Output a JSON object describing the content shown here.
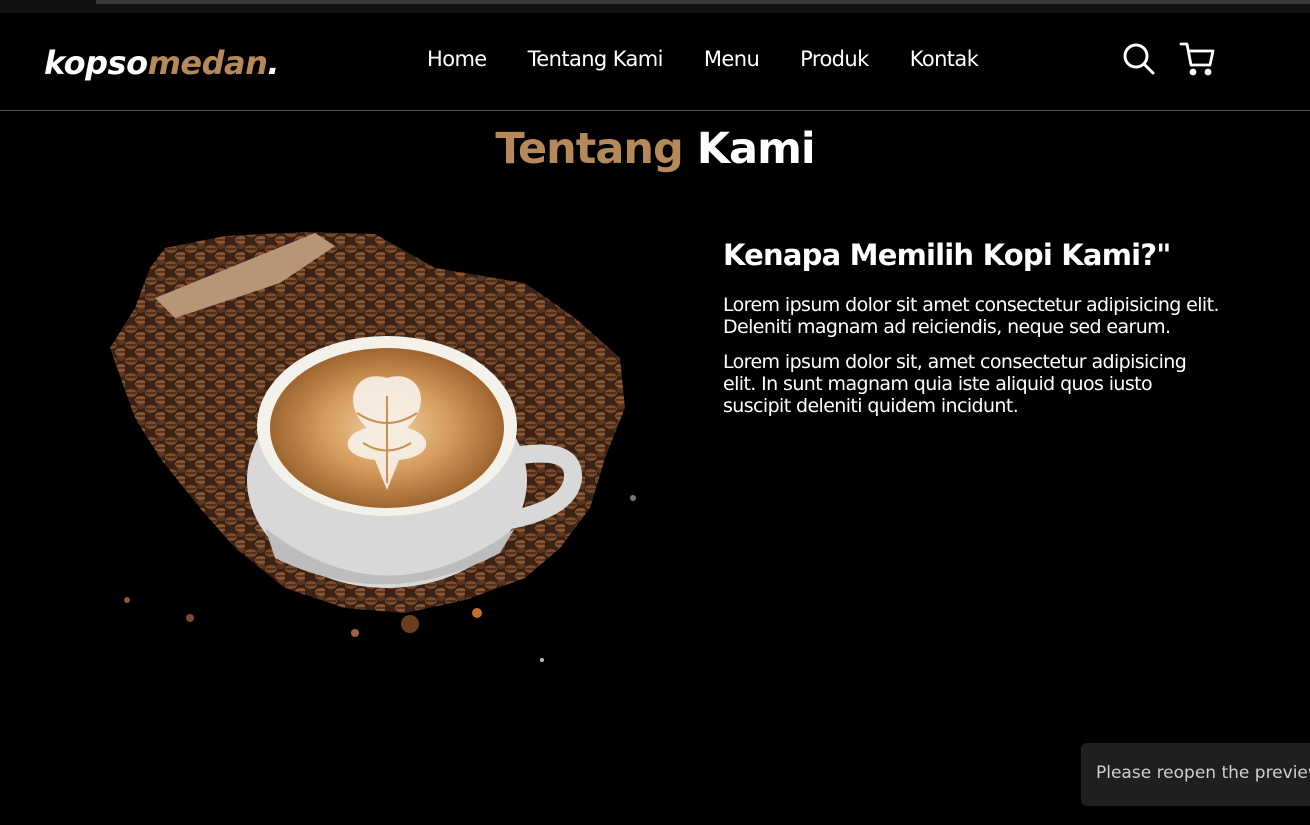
{
  "header": {
    "logo": {
      "part1": "kopso",
      "part2": "medan",
      "part3": "."
    },
    "nav": [
      {
        "label": "Home"
      },
      {
        "label": "Tentang Kami"
      },
      {
        "label": "Menu"
      },
      {
        "label": "Produk"
      },
      {
        "label": "Kontak"
      }
    ],
    "icons": {
      "search": "search-icon",
      "cart": "shopping-cart-icon"
    }
  },
  "about": {
    "title_part1": "Tentang",
    "title_part2": "Kami",
    "heading": "Kenapa Memilih Kopi Kami?\"",
    "paragraphs": [
      "Lorem ipsum dolor sit amet consectetur adipisicing elit. Deleniti magnam ad reiciendis, neque sed earum.",
      "Lorem ipsum dolor sit, amet consectetur adipisicing elit. In sunt magnam quia iste aliquid quos iusto suscipit deleniti quidem incidunt."
    ]
  },
  "toast": {
    "message": "Please reopen the preview."
  },
  "colors": {
    "accent": "#b6895b",
    "background": "#000000",
    "text": "#ffffff"
  }
}
